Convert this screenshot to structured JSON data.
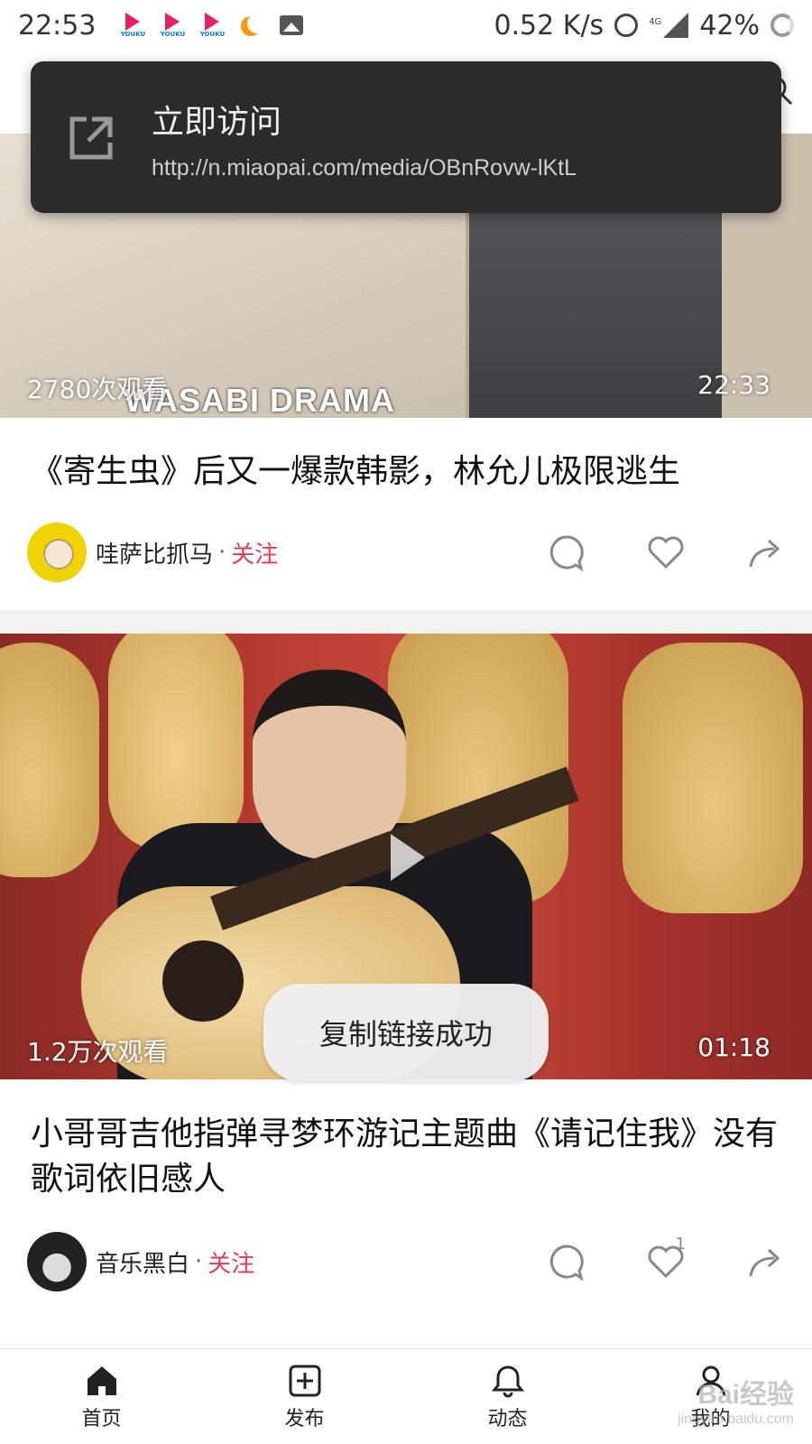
{
  "status_bar": {
    "time": "22:53",
    "net_speed": "0.52 K/s",
    "network": "4G",
    "battery": "42%",
    "app_icons": [
      "youku-icon",
      "youku-icon",
      "youku-icon",
      "moon-icon",
      "image-icon"
    ],
    "app_icon_label": "YOUKU"
  },
  "notification": {
    "title": "立即访问",
    "url": "http://n.miaopai.com/media/OBnRovw-lKtL"
  },
  "videos": [
    {
      "views": "2780次观看",
      "duration": "22:33",
      "thumb_caption": "WASABI DRAMA",
      "title": "《寄生虫》后又一爆款韩影，林允儿极限逃生",
      "author": "哇萨比抓马",
      "follow_label": "关注",
      "like_count": ""
    },
    {
      "views": "1.2万次观看",
      "duration": "01:18",
      "title": "小哥哥吉他指弹寻梦环游记主题曲《请记住我》没有歌词依旧感人",
      "author": "音乐黑白",
      "follow_label": "关注",
      "like_count": "1"
    }
  ],
  "toast": {
    "copy_success": "复制链接成功"
  },
  "bottom_nav": [
    {
      "label": "首页",
      "icon": "home-icon",
      "active": true
    },
    {
      "label": "发布",
      "icon": "publish-icon",
      "active": false
    },
    {
      "label": "动态",
      "icon": "bell-icon",
      "active": false
    },
    {
      "label": "我的",
      "icon": "profile-icon",
      "active": false
    }
  ],
  "watermark": {
    "main": "Bai经验",
    "sub": "jingyan.baidu.com"
  },
  "colors": {
    "accent": "#e5395a",
    "toast_bg": "#2b2b2b"
  }
}
